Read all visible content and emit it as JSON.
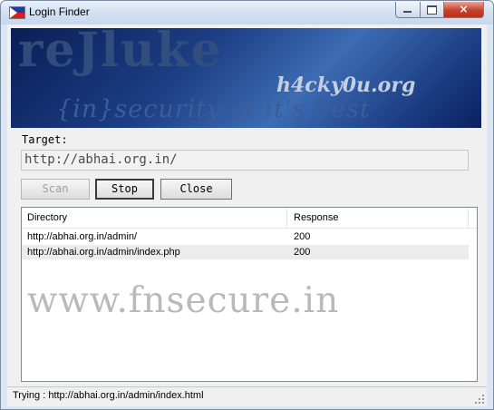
{
  "window": {
    "title": "Login Finder",
    "icon": "philippines-flag-icon",
    "close_glyph": "×"
  },
  "banner": {
    "main_text": "reJluke",
    "site_text": "h4cky0u.org",
    "tagline": "{in}security at it's best"
  },
  "target": {
    "label": "Target:",
    "value": "http://abhai.org.in/"
  },
  "buttons": {
    "scan": "Scan",
    "stop": "Stop",
    "close": "Close"
  },
  "results": {
    "columns": [
      "Directory",
      "Response"
    ],
    "rows": [
      {
        "directory": "http://abhai.org.in/admin/",
        "response": "200"
      },
      {
        "directory": "http://abhai.org.in/admin/index.php",
        "response": "200"
      }
    ]
  },
  "watermark": "www.fnsecure.in",
  "status": {
    "text": "Trying : http://abhai.org.in/admin/index.html"
  },
  "colors": {
    "title_bar": "#d3e0f0",
    "banner_bg": "#1d3f86",
    "close_button": "#c8402b"
  }
}
